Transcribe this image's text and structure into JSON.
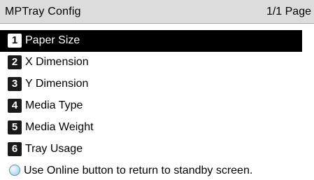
{
  "header": {
    "title": "MPTray Config",
    "page_indicator": "1/1 Page"
  },
  "menu": {
    "selected_index": 0,
    "items": [
      {
        "number": "1",
        "label": "Paper Size"
      },
      {
        "number": "2",
        "label": "X Dimension"
      },
      {
        "number": "3",
        "label": "Y Dimension"
      },
      {
        "number": "4",
        "label": "Media Type"
      },
      {
        "number": "5",
        "label": "Media Weight"
      },
      {
        "number": "6",
        "label": "Tray Usage"
      }
    ]
  },
  "footer": {
    "icon": "online-button-icon",
    "message": "Use Online button to return to standby screen."
  },
  "colors": {
    "header_bg": "#dcdcdc",
    "selected_bg": "#000000",
    "number_badge_bg": "#1a1a1a"
  }
}
